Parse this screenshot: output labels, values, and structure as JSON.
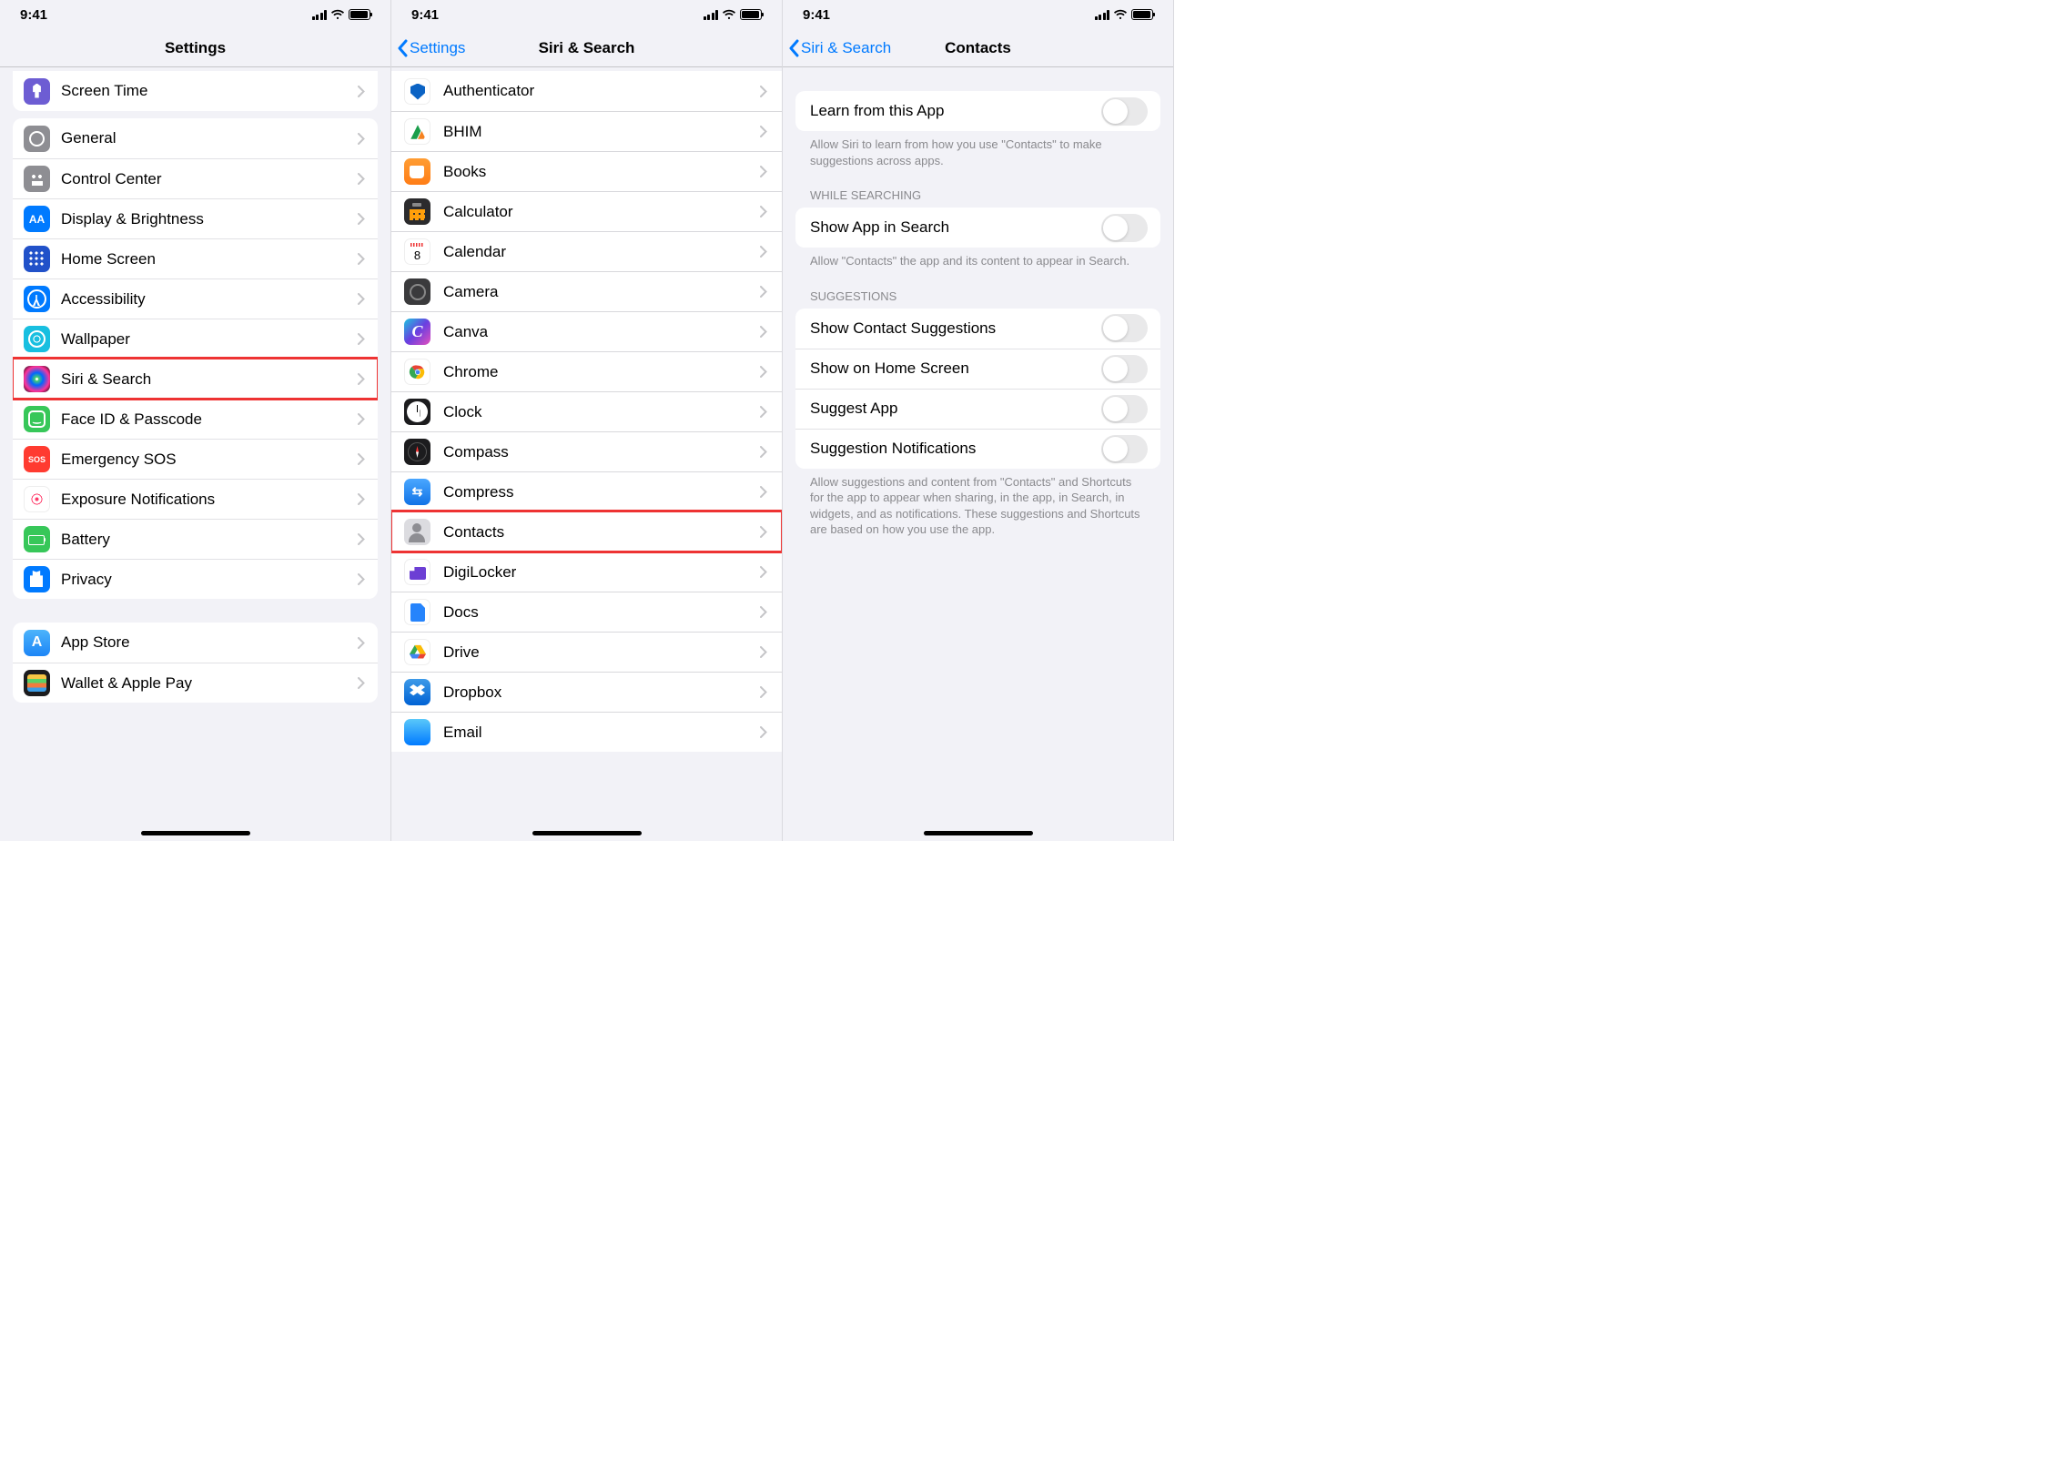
{
  "status": {
    "time": "9:41"
  },
  "pane1": {
    "title": "Settings",
    "topRow": {
      "label": "Screen Time",
      "iconClass": "ic-screen",
      "name": "row-screen-time"
    },
    "group1": [
      {
        "label": "General",
        "iconClass": "ic-general",
        "name": "row-general"
      },
      {
        "label": "Control Center",
        "iconClass": "ic-cc",
        "name": "row-control-center"
      },
      {
        "label": "Display & Brightness",
        "iconClass": "ic-disp",
        "name": "row-display-brightness"
      },
      {
        "label": "Home Screen",
        "iconClass": "ic-home",
        "name": "row-home-screen"
      },
      {
        "label": "Accessibility",
        "iconClass": "ic-acc",
        "name": "row-accessibility"
      },
      {
        "label": "Wallpaper",
        "iconClass": "ic-wall",
        "name": "row-wallpaper"
      },
      {
        "label": "Siri & Search",
        "iconClass": "ic-siri",
        "name": "row-siri-search",
        "highlight": true
      },
      {
        "label": "Face ID & Passcode",
        "iconClass": "ic-face",
        "name": "row-faceid"
      },
      {
        "label": "Emergency SOS",
        "iconClass": "ic-sos",
        "name": "row-sos"
      },
      {
        "label": "Exposure Notifications",
        "iconClass": "ic-expo",
        "name": "row-exposure"
      },
      {
        "label": "Battery",
        "iconClass": "ic-batt",
        "name": "row-battery"
      },
      {
        "label": "Privacy",
        "iconClass": "ic-priv",
        "name": "row-privacy"
      }
    ],
    "group2": [
      {
        "label": "App Store",
        "iconClass": "ic-store",
        "name": "row-app-store"
      },
      {
        "label": "Wallet & Apple Pay",
        "iconClass": "ic-wallet",
        "name": "row-wallet"
      }
    ]
  },
  "pane2": {
    "back": "Settings",
    "title": "Siri & Search",
    "rows": [
      {
        "label": "Authenticator",
        "iconClass": "ic-auth",
        "name": "row-authenticator"
      },
      {
        "label": "BHIM",
        "iconClass": "ic-bhim",
        "name": "row-bhim",
        "svg": "bhim"
      },
      {
        "label": "Books",
        "iconClass": "ic-books",
        "name": "row-books"
      },
      {
        "label": "Calculator",
        "iconClass": "ic-calc",
        "name": "row-calculator"
      },
      {
        "label": "Calendar",
        "iconClass": "ic-cal",
        "name": "row-calendar"
      },
      {
        "label": "Camera",
        "iconClass": "ic-cam",
        "name": "row-camera"
      },
      {
        "label": "Canva",
        "iconClass": "ic-canva",
        "name": "row-canva"
      },
      {
        "label": "Chrome",
        "iconClass": "ic-chrome",
        "name": "row-chrome",
        "svg": "chrome"
      },
      {
        "label": "Clock",
        "iconClass": "ic-clock",
        "name": "row-clock"
      },
      {
        "label": "Compass",
        "iconClass": "ic-compass",
        "name": "row-compass"
      },
      {
        "label": "Compress",
        "iconClass": "ic-compress",
        "name": "row-compress"
      },
      {
        "label": "Contacts",
        "iconClass": "ic-contacts",
        "name": "row-contacts",
        "highlight": true
      },
      {
        "label": "DigiLocker",
        "iconClass": "ic-digi",
        "name": "row-digilocker"
      },
      {
        "label": "Docs",
        "iconClass": "ic-docs",
        "name": "row-docs"
      },
      {
        "label": "Drive",
        "iconClass": "ic-drive",
        "name": "row-drive",
        "svg": "drive"
      },
      {
        "label": "Dropbox",
        "iconClass": "ic-dropbox",
        "name": "row-dropbox"
      },
      {
        "label": "Email",
        "iconClass": "ic-email",
        "name": "row-email"
      }
    ]
  },
  "pane3": {
    "back": "Siri & Search",
    "title": "Contacts",
    "section1": {
      "rows": [
        {
          "label": "Learn from this App",
          "name": "toggle-learn-from-app"
        }
      ],
      "footer": "Allow Siri to learn from how you use \"Contacts\" to make suggestions across apps."
    },
    "section2": {
      "header": "WHILE SEARCHING",
      "rows": [
        {
          "label": "Show App in Search",
          "name": "toggle-show-in-search"
        }
      ],
      "footer": "Allow \"Contacts\" the app and its content to appear in Search."
    },
    "section3": {
      "header": "SUGGESTIONS",
      "rows": [
        {
          "label": "Show Contact Suggestions",
          "name": "toggle-contact-suggestions"
        },
        {
          "label": "Show on Home Screen",
          "name": "toggle-show-home-screen"
        },
        {
          "label": "Suggest App",
          "name": "toggle-suggest-app"
        },
        {
          "label": "Suggestion Notifications",
          "name": "toggle-suggestion-notifications"
        }
      ],
      "footer": "Allow suggestions and content from \"Contacts\" and Shortcuts for the app to appear when sharing, in the app, in Search, in widgets, and as notifications. These suggestions and Shortcuts are based on how you use the app."
    }
  }
}
